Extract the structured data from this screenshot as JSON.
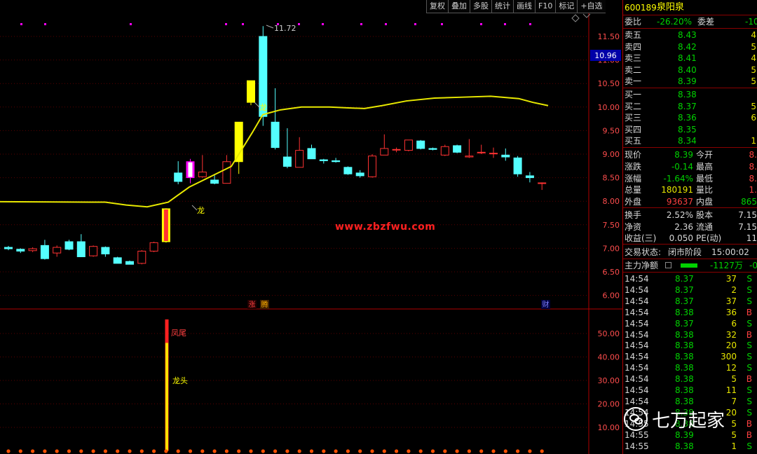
{
  "toolbar": [
    "复权",
    "叠加",
    "多股",
    "统计",
    "画线",
    "F10",
    "标记",
    "+自选"
  ],
  "main": {
    "price_ticks": [
      "11.50",
      "11.00",
      "10.50",
      "10.00",
      "9.50",
      "9.00",
      "8.50",
      "8.00",
      "7.50",
      "7.00",
      "6.50",
      "6.00"
    ],
    "current_price_box": "10.96",
    "max_price_label": "11.72",
    "tag_long_1": "龙",
    "tag_long_2": "龙",
    "event_zhang": "涨",
    "event_second": "腾",
    "event_cai": "财",
    "indicator_ticks": [
      "50.00",
      "40.00",
      "30.00",
      "20.00",
      "10.00"
    ],
    "label_fengwei": "凤尾",
    "label_longtou": "龙头",
    "watermark": "www.zbzfwu.com",
    "colors": {
      "up": "#ff3232",
      "down": "#54ffff",
      "yellow": "#ffff00",
      "magenta": "#ff00ff",
      "ma": "#e8e800"
    }
  },
  "chart_data": {
    "type": "candlestick",
    "ylim": [
      5.95,
      11.8
    ],
    "candles": [
      {
        "o": 7.02,
        "h": 7.05,
        "l": 6.96,
        "c": 6.99
      },
      {
        "o": 6.98,
        "h": 7.0,
        "l": 6.9,
        "c": 6.94
      },
      {
        "o": 6.95,
        "h": 7.02,
        "l": 6.92,
        "c": 6.99
      },
      {
        "o": 7.06,
        "h": 7.18,
        "l": 6.76,
        "c": 6.78
      },
      {
        "o": 6.9,
        "h": 7.06,
        "l": 6.82,
        "c": 7.02
      },
      {
        "o": 7.14,
        "h": 7.18,
        "l": 6.96,
        "c": 6.98
      },
      {
        "o": 7.14,
        "h": 7.3,
        "l": 6.82,
        "c": 6.82
      },
      {
        "o": 6.84,
        "h": 7.06,
        "l": 6.82,
        "c": 7.04
      },
      {
        "o": 7.02,
        "h": 7.04,
        "l": 6.82,
        "c": 6.88
      },
      {
        "o": 6.8,
        "h": 6.82,
        "l": 6.68,
        "c": 6.68
      },
      {
        "o": 6.72,
        "h": 6.74,
        "l": 6.66,
        "c": 6.66
      },
      {
        "o": 6.68,
        "h": 6.96,
        "l": 6.66,
        "c": 6.94
      },
      {
        "o": 6.94,
        "h": 7.14,
        "l": 6.92,
        "c": 7.12
      },
      {
        "o": 7.14,
        "h": 7.85,
        "l": 7.12,
        "c": 7.84,
        "mark": "yellow"
      },
      {
        "o": 8.6,
        "h": 8.85,
        "l": 8.36,
        "c": 8.42
      },
      {
        "o": 8.5,
        "h": 8.9,
        "l": 8.38,
        "c": 8.84,
        "mark": "magenta"
      },
      {
        "o": 8.52,
        "h": 8.98,
        "l": 8.5,
        "c": 8.62
      },
      {
        "o": 8.45,
        "h": 8.55,
        "l": 8.36,
        "c": 8.38
      },
      {
        "o": 8.38,
        "h": 8.98,
        "l": 8.38,
        "c": 8.84
      },
      {
        "o": 8.84,
        "h": 9.68,
        "l": 8.58,
        "c": 9.68,
        "mark": "yellow"
      },
      {
        "o": 10.56,
        "h": 10.56,
        "l": 10.04,
        "c": 10.1,
        "mark": "yellow"
      },
      {
        "o": 11.5,
        "h": 11.72,
        "l": 9.6,
        "c": 9.8
      },
      {
        "o": 9.68,
        "h": 10.4,
        "l": 9.1,
        "c": 9.14
      },
      {
        "o": 8.94,
        "h": 9.55,
        "l": 8.7,
        "c": 8.74
      },
      {
        "o": 8.72,
        "h": 9.36,
        "l": 8.72,
        "c": 9.08
      },
      {
        "o": 9.12,
        "h": 9.2,
        "l": 8.9,
        "c": 8.9
      },
      {
        "o": 8.88,
        "h": 8.9,
        "l": 8.8,
        "c": 8.86
      },
      {
        "o": 8.86,
        "h": 8.92,
        "l": 8.82,
        "c": 8.84
      },
      {
        "o": 8.72,
        "h": 8.74,
        "l": 8.56,
        "c": 8.58
      },
      {
        "o": 8.6,
        "h": 8.66,
        "l": 8.5,
        "c": 8.54
      },
      {
        "o": 8.52,
        "h": 9.0,
        "l": 8.5,
        "c": 8.96
      },
      {
        "o": 8.98,
        "h": 9.42,
        "l": 8.98,
        "c": 9.12
      },
      {
        "o": 9.1,
        "h": 9.14,
        "l": 9.04,
        "c": 9.1
      },
      {
        "o": 9.08,
        "h": 9.3,
        "l": 9.06,
        "c": 9.3
      },
      {
        "o": 9.28,
        "h": 9.3,
        "l": 9.1,
        "c": 9.12
      },
      {
        "o": 9.12,
        "h": 9.14,
        "l": 9.08,
        "c": 9.1
      },
      {
        "o": 8.98,
        "h": 9.2,
        "l": 8.96,
        "c": 9.16
      },
      {
        "o": 9.18,
        "h": 9.2,
        "l": 9.02,
        "c": 9.04
      },
      {
        "o": 8.94,
        "h": 9.32,
        "l": 8.92,
        "c": 8.96
      },
      {
        "o": 9.04,
        "h": 9.2,
        "l": 9.0,
        "c": 9.04
      },
      {
        "o": 9.02,
        "h": 9.14,
        "l": 8.92,
        "c": 9.02
      },
      {
        "o": 8.98,
        "h": 9.12,
        "l": 8.86,
        "c": 8.94
      },
      {
        "o": 8.92,
        "h": 8.96,
        "l": 8.52,
        "c": 8.58
      },
      {
        "o": 8.54,
        "h": 8.62,
        "l": 8.4,
        "c": 8.5
      },
      {
        "o": 8.38,
        "h": 8.4,
        "l": 8.24,
        "c": 8.39
      }
    ],
    "ma": [
      [
        0,
        7.99
      ],
      [
        150,
        7.98
      ],
      [
        180,
        7.92
      ],
      [
        210,
        7.88
      ],
      [
        240,
        7.98
      ],
      [
        270,
        8.3
      ],
      [
        300,
        8.52
      ],
      [
        330,
        8.74
      ],
      [
        360,
        9.46
      ],
      [
        375,
        9.84
      ],
      [
        400,
        9.94
      ],
      [
        430,
        10.0
      ],
      [
        470,
        10.0
      ],
      [
        500,
        9.98
      ],
      [
        520,
        9.97
      ],
      [
        545,
        10.03
      ],
      [
        580,
        10.13
      ],
      [
        620,
        10.19
      ],
      [
        660,
        10.21
      ],
      [
        700,
        10.23
      ],
      [
        740,
        10.18
      ],
      [
        760,
        10.1
      ],
      [
        782,
        10.03
      ]
    ],
    "indicator": {
      "ylim": [
        0,
        58
      ],
      "fengwei": 56,
      "longtou": 46
    }
  },
  "panel": {
    "code": "600189",
    "name": "泉阳泉",
    "weibi_label": "委比",
    "weibi_value": "-26.20%",
    "weicha_label": "委差",
    "weicha_value": "-10",
    "asks": [
      {
        "label": "卖五",
        "price": "8.43",
        "vol": "4"
      },
      {
        "label": "卖四",
        "price": "8.42",
        "vol": "5"
      },
      {
        "label": "卖三",
        "price": "8.41",
        "vol": "4"
      },
      {
        "label": "卖二",
        "price": "8.40",
        "vol": "5"
      },
      {
        "label": "卖一",
        "price": "8.39",
        "vol": "5"
      }
    ],
    "bids": [
      {
        "label": "买一",
        "price": "8.38",
        "vol": ""
      },
      {
        "label": "买二",
        "price": "8.37",
        "vol": "5"
      },
      {
        "label": "买三",
        "price": "8.36",
        "vol": "6"
      },
      {
        "label": "买四",
        "price": "8.35",
        "vol": ""
      },
      {
        "label": "买五",
        "price": "8.34",
        "vol": "1"
      }
    ],
    "stats": [
      {
        "l1": "现价",
        "v1": "8.39",
        "l2": "今开",
        "v2": "8."
      },
      {
        "l1": "涨跌",
        "v1": "-0.14",
        "l2": "最高",
        "v2": "8."
      },
      {
        "l1": "涨幅",
        "v1": "-1.64%",
        "l2": "最低",
        "v2": "8."
      },
      {
        "l1": "总量",
        "v1": "180191",
        "l2": "量比",
        "v2": "1."
      },
      {
        "l1": "外盘",
        "v1": "93637",
        "l2": "内盘",
        "v2": "865"
      }
    ],
    "stats2": [
      {
        "l1": "换手",
        "v1": "2.52%",
        "l2": "股本",
        "v2": "7.15"
      },
      {
        "l1": "净资",
        "v1": "2.36",
        "l2": "流通",
        "v2": "7.15"
      },
      {
        "l1": "收益(三)",
        "v1": "0.050",
        "l2": "PE(动)",
        "v2": "11"
      }
    ],
    "status_label": "交易状态:",
    "status_value": "闭市阶段",
    "status_time": "15:00:02",
    "zhuli_label": "主力净额",
    "zhuli_value": "-1127万",
    "zhuli_extra": "-0",
    "ticks": [
      {
        "t": "14:54",
        "p": "8.37",
        "v": "37",
        "s": "S"
      },
      {
        "t": "14:54",
        "p": "8.37",
        "v": "2",
        "s": "S"
      },
      {
        "t": "14:54",
        "p": "8.37",
        "v": "37",
        "s": "S"
      },
      {
        "t": "14:54",
        "p": "8.38",
        "v": "36",
        "s": "B"
      },
      {
        "t": "14:54",
        "p": "8.37",
        "v": "6",
        "s": "S"
      },
      {
        "t": "14:54",
        "p": "8.38",
        "v": "32",
        "s": "B"
      },
      {
        "t": "14:54",
        "p": "8.38",
        "v": "20",
        "s": "S"
      },
      {
        "t": "14:54",
        "p": "8.38",
        "v": "300",
        "s": "S"
      },
      {
        "t": "14:54",
        "p": "8.38",
        "v": "12",
        "s": "S"
      },
      {
        "t": "14:54",
        "p": "8.38",
        "v": "5",
        "s": "B"
      },
      {
        "t": "14:54",
        "p": "8.38",
        "v": "11",
        "s": "S"
      },
      {
        "t": "14:54",
        "p": "8.38",
        "v": "7",
        "s": "S"
      },
      {
        "t": "14:54",
        "p": "8.38",
        "v": "20",
        "s": "S"
      },
      {
        "t": "14:55",
        "p": "8.38",
        "v": "5",
        "s": "B"
      },
      {
        "t": "14:55",
        "p": "8.39",
        "v": "5",
        "s": "B"
      },
      {
        "t": "14:55",
        "p": "8.38",
        "v": "1",
        "s": "S"
      }
    ],
    "overlay_text": "七万起家"
  }
}
